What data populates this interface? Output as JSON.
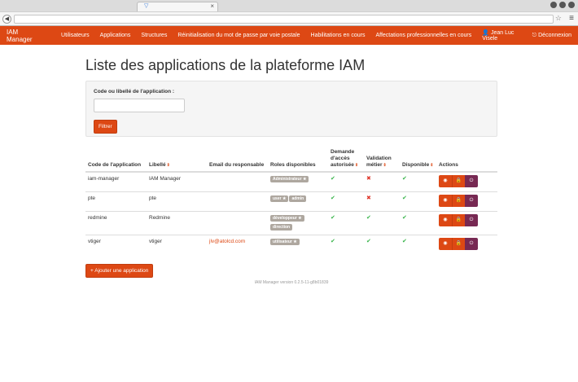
{
  "browser": {
    "url": "",
    "tab_icon": "▽",
    "tab_close": "×"
  },
  "navbar": {
    "brand": "IAM Manager",
    "items": [
      "Utilisateurs",
      "Applications",
      "Structures",
      "Réinitialisation du mot de passe par voie postale",
      "Habilitations en cours",
      "Affectations professionnelles en cours"
    ],
    "user": "Jean Luc Visele",
    "logout": "Déconnexion"
  },
  "page": {
    "title": "Liste des applications de la plateforme IAM",
    "filter_label": "Code ou libellé de l'application :",
    "filter_placeholder": "",
    "filter_button": "Filtrer",
    "add_button": "+ Ajouter une application",
    "footer": "IAM Manager version 0.2.5-11-g8b01839"
  },
  "table": {
    "headers": {
      "code": "Code de l'application",
      "libelle": "Libellé",
      "email": "Email du responsable",
      "roles": "Roles disponibles",
      "demande": "Demande d'accès autorisée",
      "validation": "Validation métier",
      "disponible": "Disponible",
      "actions": "Actions"
    },
    "rows": [
      {
        "code": "iam-manager",
        "libelle": "IAM Manager",
        "email": "",
        "roles": [
          "Administrateur ★"
        ],
        "demande": "✔",
        "validation": "✖",
        "disponible": "✔"
      },
      {
        "code": "pte",
        "libelle": "pte",
        "email": "",
        "roles": [
          "user ★",
          "admin"
        ],
        "demande": "✔",
        "validation": "✖",
        "disponible": "✔"
      },
      {
        "code": "redmine",
        "libelle": "Redmine",
        "email": "",
        "roles": [
          "développeur ★",
          "direction"
        ],
        "demande": "✔",
        "validation": "✔",
        "disponible": "✔"
      },
      {
        "code": "vtiger",
        "libelle": "vtiger",
        "email": "jlv@atolcd.com",
        "roles": [
          "utilisateur ★"
        ],
        "demande": "✔",
        "validation": "✔",
        "disponible": "✔"
      }
    ]
  },
  "icons": {
    "sort": "⇕",
    "eye": "◉",
    "lock": "🔒",
    "power": "⏻",
    "user": "👤",
    "logout": "⎋"
  },
  "colors": {
    "accent": "#dd4814",
    "purple": "#772953",
    "check": "#38b44a",
    "cross": "#df382c"
  }
}
